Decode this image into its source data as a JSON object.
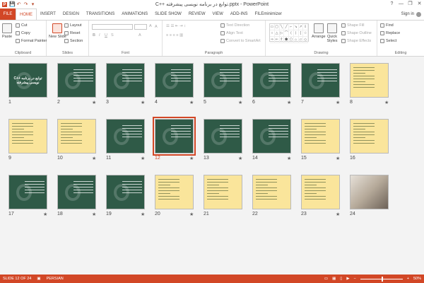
{
  "window": {
    "title": "C++ توابع در برنامه نویسی پیشرفته.pptx - PowerPoint",
    "controls": [
      "?",
      "—",
      "❐",
      "✕"
    ]
  },
  "qat": {
    "app_icon": "P",
    "save": "💾",
    "undo": "↶",
    "redo": "↷",
    "customize": "▾"
  },
  "tabs": {
    "file": "FILE",
    "items": [
      "HOME",
      "INSERT",
      "DESIGN",
      "TRANSITIONS",
      "ANIMATIONS",
      "SLIDE SHOW",
      "REVIEW",
      "VIEW",
      "ADD-INS",
      "FILEminimizer"
    ],
    "active_index": 0,
    "sign_in": "Sign in"
  },
  "ribbon": {
    "clipboard": {
      "label": "Clipboard",
      "paste": "Paste",
      "cut": "Cut",
      "copy": "Copy",
      "format_painter": "Format Painter"
    },
    "slides": {
      "label": "Slides",
      "new_slide": "New Slide",
      "layout": "Layout",
      "reset": "Reset",
      "section": "Section"
    },
    "font": {
      "label": "Font"
    },
    "paragraph": {
      "label": "Paragraph",
      "text_direction": "Text Direction",
      "align_text": "Align Text",
      "convert_smartart": "Convert to SmartArt"
    },
    "drawing": {
      "label": "Drawing",
      "arrange": "Arrange",
      "quick_styles": "Quick Styles",
      "shape_fill": "Shape Fill",
      "shape_outline": "Shape Outline",
      "shape_effects": "Shape Effects"
    },
    "editing": {
      "label": "Editing",
      "find": "Find",
      "replace": "Replace",
      "select": "Select"
    }
  },
  "slides": [
    {
      "num": "1",
      "style": "dark-title",
      "star": ""
    },
    {
      "num": "2",
      "style": "dark",
      "star": "★"
    },
    {
      "num": "3",
      "style": "dark",
      "star": "★"
    },
    {
      "num": "4",
      "style": "dark",
      "star": "★"
    },
    {
      "num": "5",
      "style": "dark",
      "star": "★"
    },
    {
      "num": "6",
      "style": "dark",
      "star": "★"
    },
    {
      "num": "7",
      "style": "dark",
      "star": "★"
    },
    {
      "num": "8",
      "style": "yellow",
      "star": "★"
    },
    {
      "num": "9",
      "style": "yellow",
      "star": ""
    },
    {
      "num": "10",
      "style": "yellow",
      "star": "★"
    },
    {
      "num": "11",
      "style": "dark",
      "star": "★"
    },
    {
      "num": "12",
      "style": "dark",
      "star": "★"
    },
    {
      "num": "13",
      "style": "dark",
      "star": "★"
    },
    {
      "num": "14",
      "style": "dark",
      "star": "★"
    },
    {
      "num": "15",
      "style": "yellow",
      "star": "★"
    },
    {
      "num": "16",
      "style": "yellow",
      "star": ""
    },
    {
      "num": "17",
      "style": "dark",
      "star": "★"
    },
    {
      "num": "18",
      "style": "dark",
      "star": "★"
    },
    {
      "num": "19",
      "style": "dark",
      "star": "★"
    },
    {
      "num": "20",
      "style": "yellow",
      "star": "★"
    },
    {
      "num": "21",
      "style": "yellow",
      "star": ""
    },
    {
      "num": "22",
      "style": "yellow",
      "star": ""
    },
    {
      "num": "23",
      "style": "yellow",
      "star": "★"
    },
    {
      "num": "24",
      "style": "photo",
      "star": ""
    }
  ],
  "slide1_title": "C++ توابع در برنامه نویسی پیشرفته",
  "selected_slide": "12",
  "status": {
    "slide_info": "SLIDE 12 OF 24",
    "language": "PERSIAN",
    "zoom": "50%"
  }
}
